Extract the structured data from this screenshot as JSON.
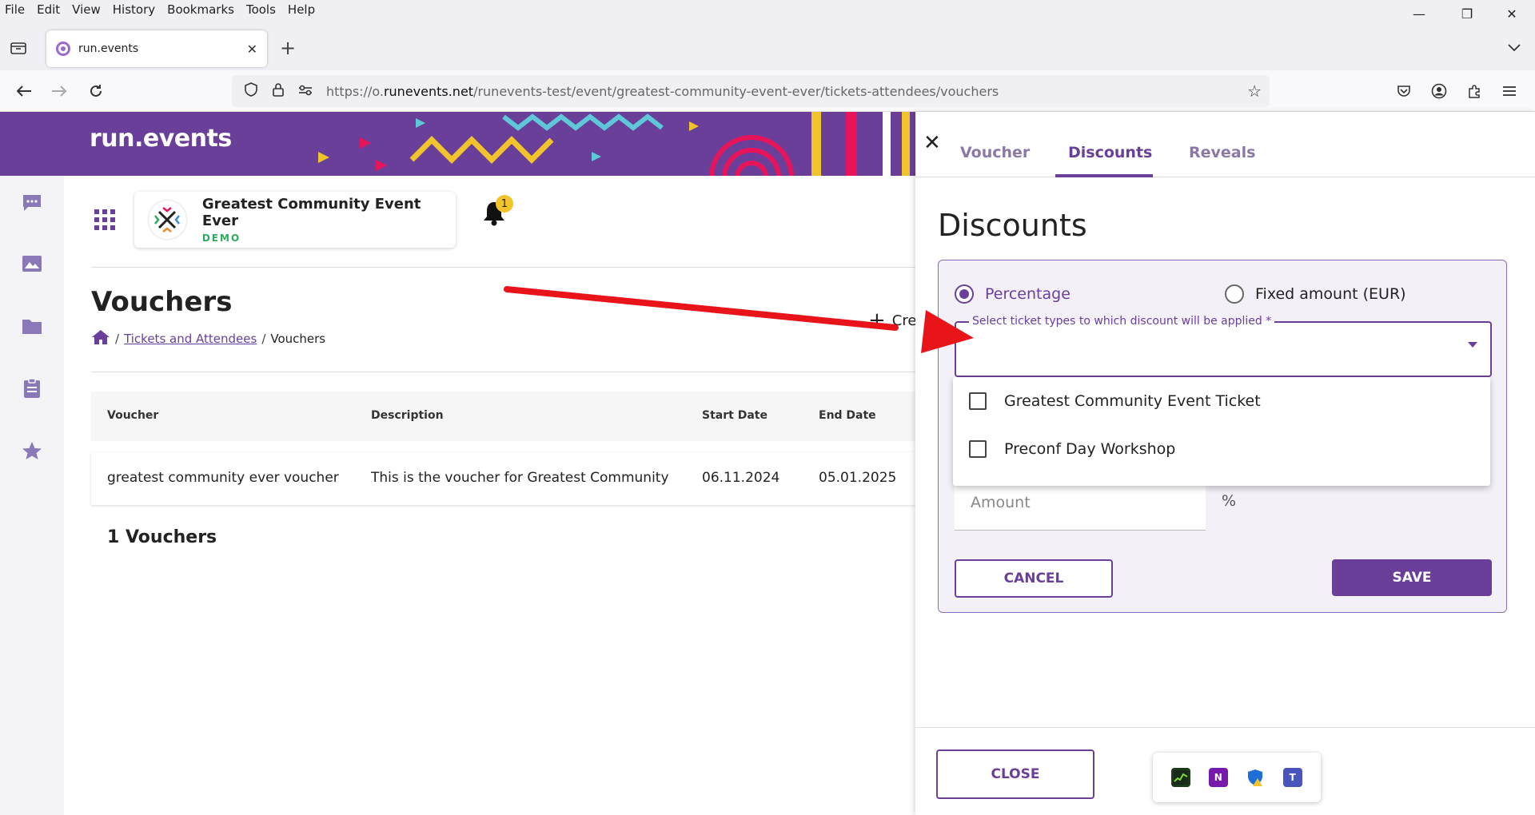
{
  "browser": {
    "menu": [
      "File",
      "Edit",
      "View",
      "History",
      "Bookmarks",
      "Tools",
      "Help"
    ],
    "tab_title": "run.events",
    "url_prefix": "https://o.",
    "url_domain": "runevents.net",
    "url_path": "/runevents-test/event/greatest-community-event-ever/tickets-attendees/vouchers"
  },
  "brand": {
    "name": "run.events"
  },
  "event": {
    "title": "Greatest Community Event Ever",
    "badge": "DEMO",
    "notifications": "1"
  },
  "page": {
    "title": "Vouchers",
    "breadcrumb": {
      "sep": "/",
      "link": "Tickets and Attendees",
      "current": "Vouchers"
    },
    "create_label": "Cre"
  },
  "table": {
    "headers": [
      "Voucher",
      "Description",
      "Start Date",
      "End Date"
    ],
    "rows": [
      [
        "greatest community ever voucher",
        "This is the voucher for Greatest Community",
        "06.11.2024",
        "05.01.2025"
      ]
    ],
    "count_label": "1 Vouchers"
  },
  "drawer": {
    "tabs": [
      "Voucher",
      "Discounts",
      "Reveals"
    ],
    "active_tab": "Discounts",
    "title": "Discounts",
    "radio_percentage": "Percentage",
    "radio_fixed": "Fixed amount (EUR)",
    "select_label": "Select ticket types to which discount will be applied *",
    "options": [
      "Greatest Community Event Ticket",
      "Preconf Day Workshop"
    ],
    "amount_placeholder": "Amount",
    "percent": "%",
    "cancel": "CANCEL",
    "save": "SAVE",
    "close": "CLOSE"
  },
  "colors": {
    "brand": "#6a3f9a",
    "demo": "#2daa5f",
    "annotation": "#e8141a"
  }
}
